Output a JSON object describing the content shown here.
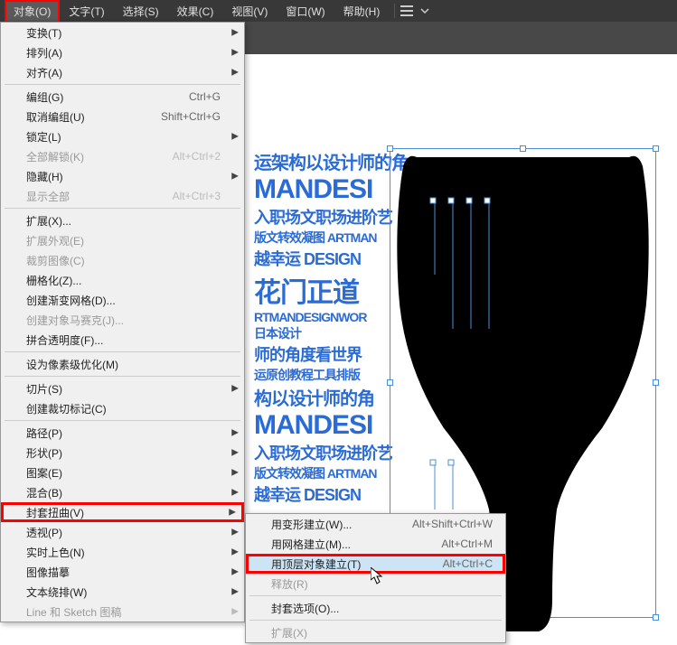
{
  "menubar": {
    "items": [
      "对象(O)",
      "文字(T)",
      "选择(S)",
      "效果(C)",
      "视图(V)",
      "窗口(W)",
      "帮助(H)"
    ]
  },
  "dropdown": [
    {
      "label": "变换(T)",
      "arrow": true
    },
    {
      "label": "排列(A)",
      "arrow": true
    },
    {
      "label": "对齐(A)",
      "arrow": true
    },
    {
      "sep": true
    },
    {
      "label": "编组(G)",
      "shortcut": "Ctrl+G"
    },
    {
      "label": "取消编组(U)",
      "shortcut": "Shift+Ctrl+G"
    },
    {
      "label": "锁定(L)",
      "arrow": true
    },
    {
      "label": "全部解锁(K)",
      "shortcut": "Alt+Ctrl+2",
      "disabled": true
    },
    {
      "label": "隐藏(H)",
      "arrow": true
    },
    {
      "label": "显示全部",
      "shortcut": "Alt+Ctrl+3",
      "disabled": true
    },
    {
      "sep": true
    },
    {
      "label": "扩展(X)..."
    },
    {
      "label": "扩展外观(E)",
      "disabled": true
    },
    {
      "label": "裁剪图像(C)",
      "disabled": true
    },
    {
      "label": "栅格化(Z)..."
    },
    {
      "label": "创建渐变网格(D)..."
    },
    {
      "label": "创建对象马赛克(J)...",
      "disabled": true
    },
    {
      "label": "拼合透明度(F)..."
    },
    {
      "sep": true
    },
    {
      "label": "设为像素级优化(M)"
    },
    {
      "sep": true
    },
    {
      "label": "切片(S)",
      "arrow": true
    },
    {
      "label": "创建裁切标记(C)"
    },
    {
      "sep": true
    },
    {
      "label": "路径(P)",
      "arrow": true
    },
    {
      "label": "形状(P)",
      "arrow": true
    },
    {
      "label": "图案(E)",
      "arrow": true
    },
    {
      "label": "混合(B)",
      "arrow": true
    },
    {
      "label": "封套扭曲(V)",
      "arrow": true,
      "highlight": true
    },
    {
      "label": "透视(P)",
      "arrow": true
    },
    {
      "label": "实时上色(N)",
      "arrow": true
    },
    {
      "label": "图像描摹",
      "arrow": true
    },
    {
      "label": "文本绕排(W)",
      "arrow": true
    },
    {
      "label": "Line 和 Sketch 图稿",
      "arrow": true,
      "disabled": true
    }
  ],
  "submenu": [
    {
      "label": "用变形建立(W)...",
      "shortcut": "Alt+Shift+Ctrl+W"
    },
    {
      "label": "用网格建立(M)...",
      "shortcut": "Alt+Ctrl+M"
    },
    {
      "label": "用顶层对象建立(T)",
      "shortcut": "Alt+Ctrl+C",
      "highlight": true
    },
    {
      "label": "释放(R)",
      "disabled": true
    },
    {
      "sep": true
    },
    {
      "label": "封套选项(O)..."
    },
    {
      "sep": true
    },
    {
      "label": "扩展(X)",
      "disabled": true
    }
  ],
  "art": {
    "line1": "运架构以设计师的角",
    "line2": "MANDESI",
    "line3": "入职场文职场进阶艺",
    "line4a": "版文转效凝图 ARTMAN",
    "line4b": "越幸运 DESIGN",
    "line5": "花门正道",
    "line6": "RTMANDESIGNWOR",
    "line7": "日本设计",
    "line8": "师的角度看世界",
    "line9": "运原创教程工具排版",
    "line10": "构以设计师的角"
  }
}
